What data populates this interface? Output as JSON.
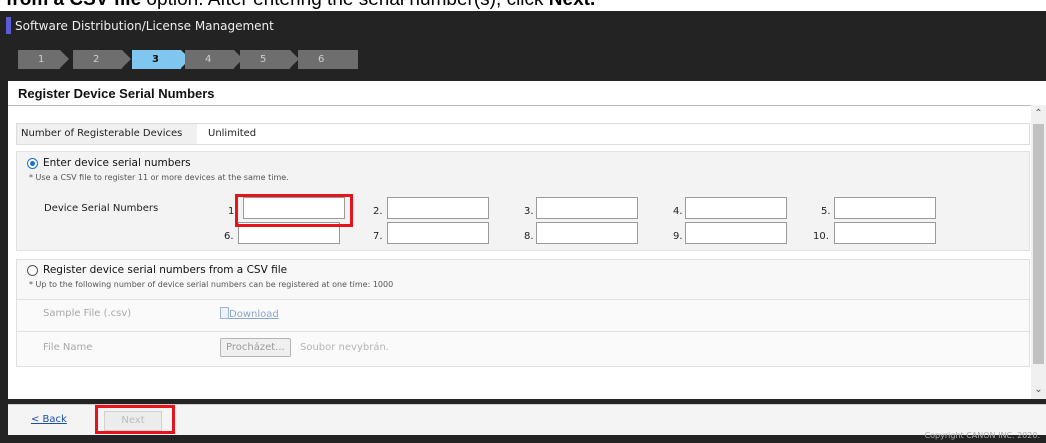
{
  "doc_caption": {
    "prefix": "from a CSV file",
    "middle": " option. After entering the serial number(s), click ",
    "bold": "Next."
  },
  "app": {
    "title": "Software Distribution/License Management",
    "copyright": "Copyright CANON INC. 2020."
  },
  "steps": [
    "1",
    "2",
    "3",
    "4",
    "5",
    "6"
  ],
  "active_step": "3",
  "section_title": "Register Device Serial Numbers",
  "registerable": {
    "label": "Number of Registerable Devices",
    "value": "Unlimited"
  },
  "option_manual": {
    "label": "Enter device serial numbers",
    "note": "* Use a CSV file to register 11 or more devices at the same time.",
    "field_label": "Device Serial Numbers",
    "fields": [
      {
        "num": "1.",
        "value": ""
      },
      {
        "num": "2.",
        "value": ""
      },
      {
        "num": "3.",
        "value": ""
      },
      {
        "num": "4.",
        "value": ""
      },
      {
        "num": "5.",
        "value": ""
      },
      {
        "num": "6.",
        "value": ""
      },
      {
        "num": "7.",
        "value": ""
      },
      {
        "num": "8.",
        "value": ""
      },
      {
        "num": "9.",
        "value": ""
      },
      {
        "num": "10.",
        "value": ""
      }
    ]
  },
  "option_csv": {
    "label": "Register device serial numbers from a CSV file",
    "note": "* Up to the following number of device serial numbers can be registered at one time: 1000",
    "sample_label": "Sample File (.csv)",
    "download_label": "Download",
    "file_label": "File Name",
    "browse_label": "Procházet...",
    "file_status": "Soubor nevybrán."
  },
  "footer": {
    "back_label": "< Back",
    "next_label": "Next"
  },
  "colors": {
    "highlight": "#e8141c",
    "active_step": "#7fc7ef",
    "link": "#1a4fb0"
  },
  "icons": [
    "download-icon",
    "radio-checked-icon",
    "radio-unchecked-icon",
    "scroll-up-icon",
    "scroll-down-icon"
  ]
}
